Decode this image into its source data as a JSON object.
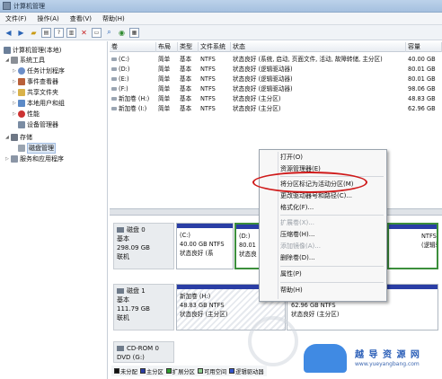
{
  "window": {
    "title": "计算机管理"
  },
  "menu": [
    "文件(F)",
    "操作(A)",
    "查看(V)",
    "帮助(H)"
  ],
  "toolbar": {
    "icons": [
      "back-icon",
      "forward-icon",
      "up-folder-icon",
      "show-tree-icon",
      "help-icon",
      "properties-icon",
      "delete-icon",
      "open-icon",
      "search-icon",
      "refresh-icon",
      "export-icon"
    ]
  },
  "tree": {
    "root": "计算机管理(本地)",
    "system_tools": "系统工具",
    "task_scheduler": "任务计划程序",
    "event_viewer": "事件查看器",
    "shared_folders": "共享文件夹",
    "local_users": "本地用户和组",
    "performance": "性能",
    "device_manager": "设备管理器",
    "storage": "存储",
    "disk_management": "磁盘管理",
    "services_apps": "服务和应用程序"
  },
  "volume_columns": [
    "卷",
    "布局",
    "类型",
    "文件系统",
    "状态",
    "容量"
  ],
  "volumes": [
    {
      "name": "(C:)",
      "layout": "简单",
      "type": "基本",
      "fs": "NTFS",
      "status": "状态良好 (系统, 启动, 页面文件, 活动, 故障转储, 主分区)",
      "capacity": "40.00 GB"
    },
    {
      "name": "(D:)",
      "layout": "简单",
      "type": "基本",
      "fs": "NTFS",
      "status": "状态良好 (逻辑驱动器)",
      "capacity": "80.01 GB"
    },
    {
      "name": "(E:)",
      "layout": "简单",
      "type": "基本",
      "fs": "NTFS",
      "status": "状态良好 (逻辑驱动器)",
      "capacity": "80.01 GB"
    },
    {
      "name": "(F:)",
      "layout": "简单",
      "type": "基本",
      "fs": "NTFS",
      "status": "状态良好 (逻辑驱动器)",
      "capacity": "98.06 GB"
    },
    {
      "name": "新加卷 (H:)",
      "layout": "简单",
      "type": "基本",
      "fs": "NTFS",
      "status": "状态良好 (主分区)",
      "capacity": "48.83 GB"
    },
    {
      "name": "新加卷 (I:)",
      "layout": "简单",
      "type": "基本",
      "fs": "NTFS",
      "status": "状态良好 (主分区)",
      "capacity": "62.96 GB"
    }
  ],
  "disks": {
    "disk0": {
      "name": "磁盘 0",
      "type": "基本",
      "size": "298.09 GB",
      "state": "联机"
    },
    "disk1": {
      "name": "磁盘 1",
      "type": "基本",
      "size": "111.79 GB",
      "state": "联机"
    },
    "cdrom": {
      "name": "CD-ROM 0",
      "type": "DVD (G:)"
    }
  },
  "partitions": {
    "c": {
      "title": "(C:)",
      "size": "40.00 GB NTFS",
      "status": "状态良好 (系"
    },
    "d": {
      "title": "(D:)",
      "size": "80.01",
      "status": "状态良"
    },
    "f": {
      "size": "NTFS",
      "status": "(逻辑驱"
    },
    "h": {
      "title": "新加卷 (H:)",
      "size": "48.83 GB NTFS",
      "status": "状态良好 (主分区)"
    },
    "i": {
      "size": "62.96 GB NTFS",
      "status": "状态良好 (主分区)"
    }
  },
  "legend": [
    "未分配",
    "主分区",
    "扩展分区",
    "可用空间",
    "逻辑驱动器"
  ],
  "legend_colors": [
    "#111111",
    "#2a3ea5",
    "#2f9d2f",
    "#8fd08f",
    "#3355cc"
  ],
  "context_menu": {
    "open": "打开(O)",
    "explorer": "资源管理器(E)",
    "mark_active": "将分区标记为活动分区(M)",
    "change_letter": "更改驱动器号和路径(C)...",
    "format": "格式化(F)...",
    "extend": "扩展卷(X)...",
    "shrink": "压缩卷(H)...",
    "add_mirror": "添加镜像(A)...",
    "delete": "删除卷(D)...",
    "properties": "属性(P)",
    "help": "帮助(H)"
  },
  "watermark": {
    "name": "越 导 资 源 网",
    "url": "www.yueyangbang.com"
  }
}
